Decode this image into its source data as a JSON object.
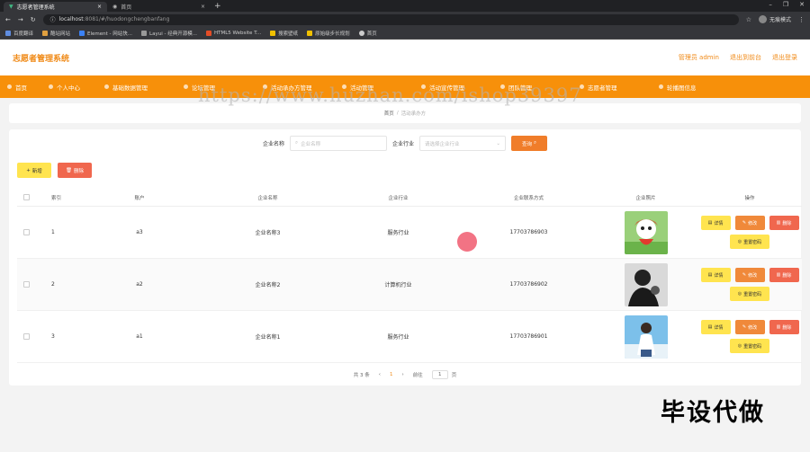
{
  "browser": {
    "tabs": [
      {
        "label": "志愿者管理系统",
        "active": true
      },
      {
        "label": "首页",
        "active": false
      }
    ],
    "url_host": "localhost",
    "url_path": ":8081/#/huodongchengbanfang",
    "profile_label": "无痕模式",
    "bookmarks": [
      "百度翻译",
      "酷站网站",
      "Element - 网站快...",
      "Layui - 经典开源模...",
      "HTML5 Website T...",
      "搜索壁纸",
      "原始级步长规划",
      "首页"
    ]
  },
  "app": {
    "title": "志愿者管理系统",
    "admin_label": "管理员 admin",
    "front_link": "退出到前台",
    "logout_link": "退出登录"
  },
  "nav": [
    "首页",
    "个人中心",
    "基础数据管理",
    "论坛管理",
    "活动承办方管理",
    "活动管理",
    "活动宣传管理",
    "团队管理",
    "志愿者管理",
    "轮播图信息"
  ],
  "breadcrumb": {
    "home": "首页",
    "sep": "/",
    "current": "活动承办方"
  },
  "search": {
    "name_label": "企业名称",
    "name_placeholder": "企业名称",
    "industry_label": "企业行业",
    "industry_placeholder": "请选择企业行业",
    "search_button": "查询"
  },
  "toolbar": {
    "add_label": "新增",
    "delete_label": "删除"
  },
  "table": {
    "headers": {
      "index": "索引",
      "user": "账户",
      "name": "企业名称",
      "industry": "企业行业",
      "phone": "企业联系方式",
      "image": "企业照片",
      "ops": "操作"
    },
    "rows": [
      {
        "index": "1",
        "user": "a3",
        "name": "企业名称3",
        "industry": "服务行业",
        "phone": "17703786903"
      },
      {
        "index": "2",
        "user": "a2",
        "name": "企业名称2",
        "industry": "计算机行业",
        "phone": "17703786902"
      },
      {
        "index": "3",
        "user": "a1",
        "name": "企业名称1",
        "industry": "服务行业",
        "phone": "17703786901"
      }
    ],
    "op_labels": {
      "detail": "详情",
      "edit": "修改",
      "delete": "删除",
      "reset": "重置密码"
    }
  },
  "pagination": {
    "total": "共 3 条",
    "current_page": "1",
    "goto_label": "前往",
    "goto_value": "1",
    "page_unit": "页"
  },
  "overlay": {
    "watermark": "https://www.huzhan.com/ishop39397",
    "corner_text": "毕设代做"
  },
  "colors": {
    "brand": "#f7900a",
    "accent": "#f08a17",
    "detail_btn": "#ffe44f",
    "delete_btn": "#f0674e"
  }
}
